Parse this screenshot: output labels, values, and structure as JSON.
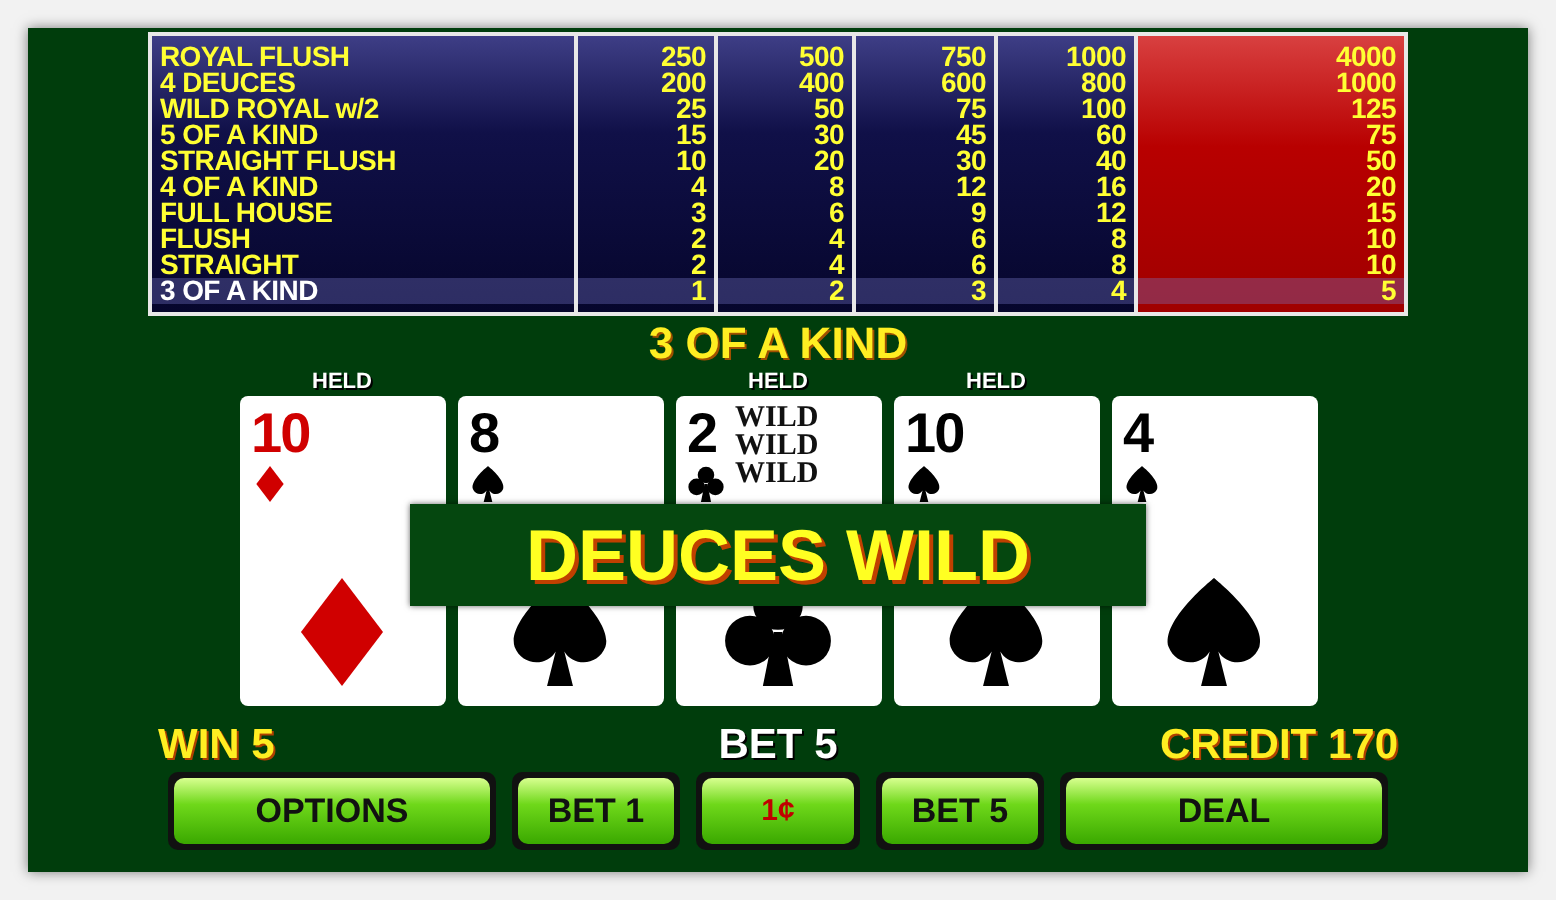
{
  "paytable": {
    "columns": [
      {
        "selected": false
      },
      {
        "selected": false
      },
      {
        "selected": false
      },
      {
        "selected": false
      },
      {
        "selected": true
      }
    ],
    "rows": [
      {
        "hand": "ROYAL FLUSH",
        "pays": [
          "250",
          "500",
          "750",
          "1000",
          "4000"
        ],
        "selected": false
      },
      {
        "hand": "4 DEUCES",
        "pays": [
          "200",
          "400",
          "600",
          "800",
          "1000"
        ],
        "selected": false
      },
      {
        "hand": "WILD ROYAL w/2",
        "pays": [
          "25",
          "50",
          "75",
          "100",
          "125"
        ],
        "selected": false
      },
      {
        "hand": "5 OF A KIND",
        "pays": [
          "15",
          "30",
          "45",
          "60",
          "75"
        ],
        "selected": false
      },
      {
        "hand": "STRAIGHT FLUSH",
        "pays": [
          "10",
          "20",
          "30",
          "40",
          "50"
        ],
        "selected": false
      },
      {
        "hand": "4 OF A KIND",
        "pays": [
          "4",
          "8",
          "12",
          "16",
          "20"
        ],
        "selected": false
      },
      {
        "hand": "FULL HOUSE",
        "pays": [
          "3",
          "6",
          "9",
          "12",
          "15"
        ],
        "selected": false
      },
      {
        "hand": "FLUSH",
        "pays": [
          "2",
          "4",
          "6",
          "8",
          "10"
        ],
        "selected": false
      },
      {
        "hand": "STRAIGHT",
        "pays": [
          "2",
          "4",
          "6",
          "8",
          "10"
        ],
        "selected": false
      },
      {
        "hand": "3 OF A KIND",
        "pays": [
          "1",
          "2",
          "3",
          "4",
          "5"
        ],
        "selected": true
      }
    ]
  },
  "result": "3 OF A KIND",
  "cards": [
    {
      "rank": "10",
      "kind": "diamonds",
      "held": true,
      "held_label": "HELD"
    },
    {
      "rank": "8",
      "kind": "spades",
      "held": false
    },
    {
      "rank": "2",
      "kind": "clubs",
      "held": true,
      "held_label": "HELD",
      "wild": [
        "WILD",
        "WILD",
        "WILD"
      ]
    },
    {
      "rank": "10",
      "kind": "spades",
      "held": true,
      "held_label": "HELD"
    },
    {
      "rank": "4",
      "kind": "spades",
      "held": false
    }
  ],
  "banner": "DEUCES WILD",
  "win": "WIN 5",
  "bet": "BET 5",
  "credit": "CREDIT 170",
  "buttons": [
    {
      "label": "OPTIONS",
      "kind": "wide"
    },
    {
      "label": "BET 1",
      "kind": "narrow"
    },
    {
      "label": "1¢",
      "kind": "denom"
    },
    {
      "label": "BET 5",
      "kind": "narrow"
    },
    {
      "label": "DEAL",
      "kind": "wide"
    }
  ]
}
